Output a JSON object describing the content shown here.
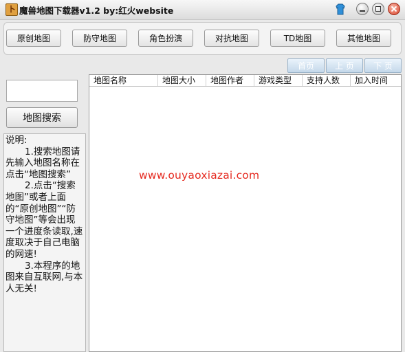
{
  "window": {
    "icon_glyph": "卜",
    "title": "魔兽地图下载器v1.2  by:红火website"
  },
  "icons": {
    "app": "warcraft-map-icon",
    "skin": "skin-shirt-icon",
    "minimize": "minimize-icon",
    "maximize": "maximize-icon",
    "close": "close-icon"
  },
  "categories": [
    "原创地图",
    "防守地图",
    "角色扮演",
    "对抗地图",
    "TD地图",
    "其他地图"
  ],
  "pager": {
    "first": "首页",
    "prev": "上 页",
    "next": "下 页"
  },
  "search": {
    "value": "",
    "button": "地图搜索"
  },
  "instructions": {
    "heading": "说明:",
    "step1": "1.搜索地图请先输入地图名称在点击“地图搜索”",
    "step2": "2.点击“搜索地图”或者上面的“原创地图”“防守地图”等会出现一个进度条读取,速度取决于自己电脑的网速!",
    "step3": "3.本程序的地图来自互联网,与本人无关!"
  },
  "table": {
    "columns": [
      "地图名称",
      "地图大小",
      "地图作者",
      "游戏类型",
      "支持人数",
      "加入时间"
    ],
    "rows": []
  },
  "watermark": "www.ouyaoxiazai.com",
  "colors": {
    "watermark": "#e5281e",
    "pager_bg": "#c4d8ea",
    "close_button": "#d9442c"
  }
}
